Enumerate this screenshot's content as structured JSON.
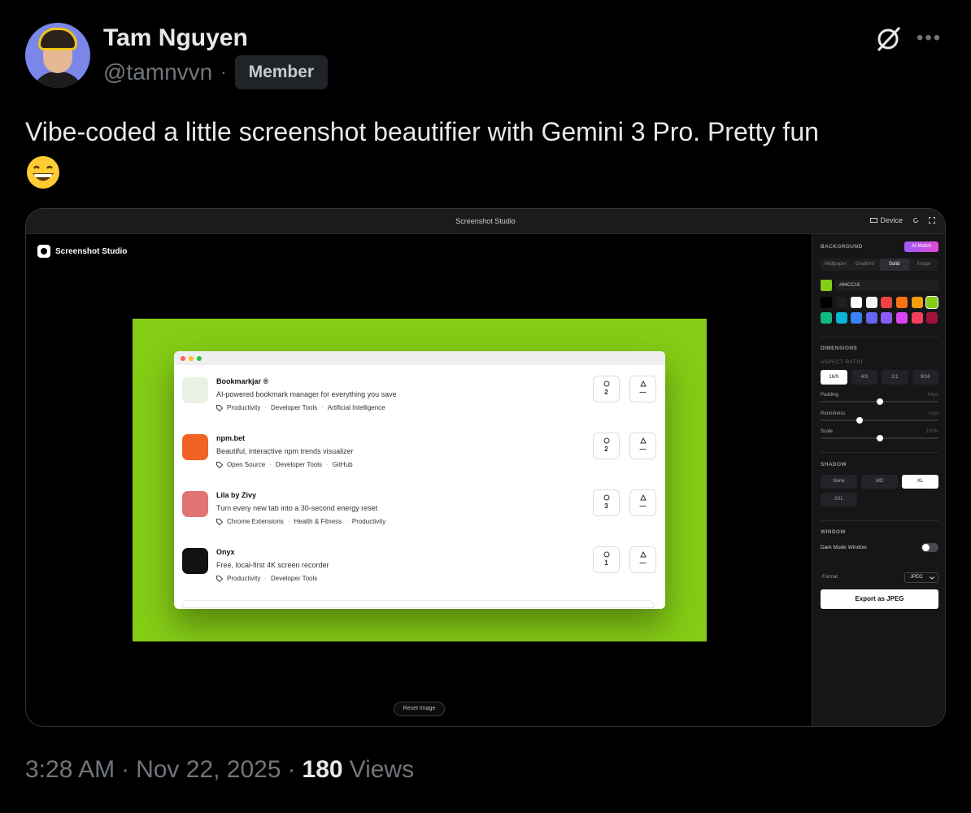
{
  "author": {
    "name": "Tam Nguyen",
    "handle": "@tamnvvn",
    "separator": "·",
    "badge": "Member"
  },
  "tweet": {
    "text": "Vibe-coded a little screenshot beautifier with Gemini 3 Pro. Pretty fun",
    "emoji": "grinning-face-with-smiling-eyes"
  },
  "app": {
    "window_title": "Screenshot Studio",
    "device_label": "Device",
    "logo_label": "Screenshot Studio",
    "reset_label": "Reset Image",
    "canvas_color": "#84CC16",
    "products": [
      {
        "name": "Bookmarkjar ®",
        "description": "AI-powered bookmark manager for everything you save",
        "tags": [
          "Productivity",
          "Developer Tools",
          "Artificial Intelligence"
        ],
        "comments": "2",
        "upvotes": "—",
        "icon_color": "#e9f0e4"
      },
      {
        "name": "npm.bet",
        "description": "Beautiful, interactive npm trends visualizer",
        "tags": [
          "Open Source",
          "Developer Tools",
          "GitHub"
        ],
        "comments": "2",
        "upvotes": "—",
        "icon_color": "#f26222"
      },
      {
        "name": "Lila by Zivy",
        "description": "Turn every new tab into a 30-second energy reset",
        "tags": [
          "Chrome Extensions",
          "Health & Fitness",
          "Productivity"
        ],
        "comments": "3",
        "upvotes": "—",
        "icon_color": "#e27373"
      },
      {
        "name": "Onyx",
        "description": "Free, local-first 4K screen recorder",
        "tags": [
          "Productivity",
          "Developer Tools"
        ],
        "comments": "1",
        "upvotes": "—",
        "icon_color": "#111111"
      }
    ],
    "sidebar": {
      "background_title": "BACKGROUND",
      "ai_match": "AI Match",
      "bg_tabs": [
        "Wallpaper",
        "Gradient",
        "Solid",
        "Image"
      ],
      "bg_tab_active": "Solid",
      "hex_value": "#84CC16",
      "swatch_colors": [
        "#000000",
        "#1f1f1f",
        "#ffffff",
        "#f4f4f5",
        "#ef4444",
        "#f97316",
        "#f59e0b",
        "#84cc16",
        "#10b981",
        "#06b6d4",
        "#3b82f6",
        "#6366f1",
        "#8b5cf6",
        "#d946ef",
        "#f43f5e",
        "#9f1239"
      ],
      "dimensions_title": "DIMENSIONS",
      "aspect_ratio_title": "ASPECT RATIO",
      "ratios": [
        "16/9",
        "4/3",
        "1/1",
        "9/16"
      ],
      "ratio_active": "16/9",
      "padding": {
        "label": "Padding",
        "value": "64px",
        "level": 0.5
      },
      "roundness": {
        "label": "Roundness",
        "value": "16px",
        "level": 0.33
      },
      "scale": {
        "label": "Scale",
        "value": "100%",
        "level": 0.5
      },
      "shadow_title": "SHADOW",
      "shadows": [
        "None",
        "MD",
        "XL",
        "2XL"
      ],
      "shadow_active": "XL",
      "window_title": "WINDOW",
      "dark_mode_label": "Dark Mode Window",
      "dark_mode_on": false,
      "format_label": "Format",
      "format_value": "JPEG",
      "export_label": "Export as JPEG"
    }
  },
  "footer": {
    "time": "3:28 AM",
    "date": "Nov 22, 2025",
    "views_count": "180",
    "views_label": "Views",
    "separator": "·"
  }
}
